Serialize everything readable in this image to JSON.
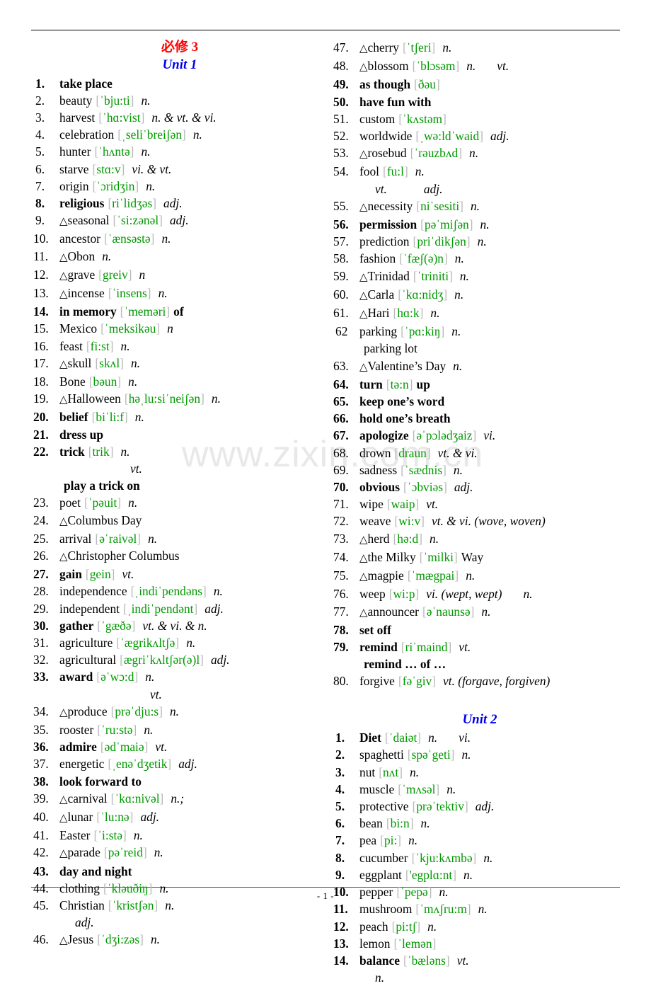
{
  "document": {
    "main_heading": "必修 3",
    "footer_page": "- 1 -",
    "watermark": "www.zixin.com.cn"
  },
  "units": [
    {
      "id": "unit-1",
      "heading": "Unit 1",
      "column": "left",
      "entries": [
        {
          "num": "1.",
          "bold": true,
          "tri": "",
          "word": "take place",
          "ph": "",
          "pos": ""
        },
        {
          "num": "2.",
          "bold": false,
          "tri": "",
          "word": "beauty",
          "ph": "ˈbju:ti",
          "pos": "n."
        },
        {
          "num": "3.",
          "bold": false,
          "tri": "",
          "word": "harvest",
          "ph": "ˈhɑ:vist",
          "pos": "n. & vt. & vi."
        },
        {
          "num": "4.",
          "bold": false,
          "tri": "",
          "word": "celebration",
          "ph": "ˌseliˈbreiʃən",
          "pos": "n."
        },
        {
          "num": "5.",
          "bold": false,
          "tri": "",
          "word": "hunter",
          "ph": "ˈhʌntə",
          "pos": "n."
        },
        {
          "num": "6.",
          "bold": false,
          "tri": "",
          "word": "starve",
          "ph": "stɑ:v",
          "pos": "vi. & vt."
        },
        {
          "num": "7.",
          "bold": false,
          "tri": "",
          "word": "origin",
          "ph": "ˈɔridʒin",
          "pos": "n."
        },
        {
          "num": "8.",
          "bold": true,
          "tri": "",
          "word": "religious",
          "ph": "riˈlidʒəs",
          "pos": "adj."
        },
        {
          "num": "9.",
          "bold": false,
          "tri": "△",
          "word": "seasonal",
          "ph": "ˈsi:zənəl",
          "pos": "adj."
        },
        {
          "num": "10.",
          "bold": false,
          "tri": "",
          "word": "ancestor",
          "ph": "ˈænsəstə",
          "pos": "n."
        },
        {
          "num": "11.",
          "bold": false,
          "tri": "△",
          "word": "Obon",
          "ph": "",
          "pos": "n."
        },
        {
          "num": "12.",
          "bold": false,
          "tri": "△",
          "word": "grave",
          "ph": "greiv",
          "pos": "n"
        },
        {
          "num": "13.",
          "bold": false,
          "tri": "△",
          "word": "incense",
          "ph": "ˈinsens",
          "pos": "n."
        },
        {
          "num": "14.",
          "bold": true,
          "tri": "",
          "word": "in memory",
          "ph": "ˈmeməri",
          "pos": "",
          "suffix_bold": "of"
        },
        {
          "num": "15.",
          "bold": false,
          "tri": "",
          "word": "Mexico",
          "ph": "ˈmeksikəu",
          "pos": "n"
        },
        {
          "num": "16.",
          "bold": false,
          "tri": "",
          "word": "feast",
          "ph": "fi:st",
          "pos": "n."
        },
        {
          "num": "17.",
          "bold": false,
          "tri": "△",
          "word": "skull",
          "ph": "skʌl",
          "pos": "n."
        },
        {
          "num": "18.",
          "bold": false,
          "tri": "",
          "word": "Bone",
          "ph": "bəun",
          "pos": "n."
        },
        {
          "num": "19.",
          "bold": false,
          "tri": "△",
          "word": "Halloween",
          "ph": "həˌlu:siˈneiʃən",
          "pos": "n."
        },
        {
          "num": "20.",
          "bold": true,
          "tri": "",
          "word": "belief",
          "ph": "biˈli:f",
          "pos": "n."
        },
        {
          "num": "21.",
          "bold": true,
          "tri": "",
          "word": "dress up",
          "ph": "",
          "pos": ""
        },
        {
          "num": "22.",
          "bold": true,
          "tri": "",
          "word": "trick",
          "ph": "trik",
          "pos": "n."
        },
        {
          "cont": "vt.",
          "indent": 4,
          "italic": true,
          "bold": false
        },
        {
          "cont": "play a trick on",
          "indent": 1,
          "italic": false,
          "bold": true
        },
        {
          "num": "23.",
          "bold": false,
          "tri": "",
          "word": "poet",
          "ph": "ˈpəuit",
          "pos": "n."
        },
        {
          "num": "24.",
          "bold": false,
          "tri": "△",
          "word": "Columbus Day",
          "ph": "",
          "pos": ""
        },
        {
          "num": "25.",
          "bold": false,
          "tri": "",
          "word": "arrival",
          "ph": "əˈraivəl",
          "pos": "n."
        },
        {
          "num": "26.",
          "bold": false,
          "tri": "△",
          "word": "Christopher Columbus",
          "ph": "",
          "pos": ""
        },
        {
          "num": "27.",
          "bold": true,
          "tri": "",
          "word": "gain",
          "ph": "gein",
          "pos": "vt."
        },
        {
          "num": "28.",
          "bold": false,
          "tri": "",
          "word": "independence",
          "ph": "ˌindiˈpendəns",
          "pos": "n."
        },
        {
          "num": "29.",
          "bold": false,
          "tri": "",
          "word": "independent",
          "ph": "ˌindiˈpendənt",
          "pos": "adj."
        },
        {
          "num": "30.",
          "bold": true,
          "tri": "",
          "word": "gather",
          "ph": "ˈgæðə",
          "pos": "vt. & vi. & n."
        },
        {
          "num": "31.",
          "bold": false,
          "tri": "",
          "word": "agriculture",
          "ph": "ˈægrikʌltʃə",
          "pos": "n."
        },
        {
          "num": "32.",
          "bold": false,
          "tri": "",
          "word": "agricultural",
          "ph": "ægriˈkʌltʃər(ə)l",
          "pos": "adj."
        },
        {
          "num": "33.",
          "bold": true,
          "tri": "",
          "word": "award",
          "ph": "əˈwɔ:d",
          "pos": "n."
        },
        {
          "cont": "vt.",
          "indent": 5,
          "italic": true,
          "bold": false
        },
        {
          "num": "34.",
          "bold": false,
          "tri": "△",
          "word": "produce",
          "ph": "prəˈdju:s",
          "pos": "n."
        },
        {
          "num": "35.",
          "bold": false,
          "tri": "",
          "word": "rooster",
          "ph": "ˈru:stə",
          "pos": "n."
        },
        {
          "num": "36.",
          "bold": true,
          "tri": "",
          "word": "admire",
          "ph": "ədˈmaiə",
          "pos": "vt."
        },
        {
          "num": "37.",
          "bold": false,
          "tri": "",
          "word": "energetic",
          "ph": "ˌenəˈdʒetik",
          "pos": "adj."
        },
        {
          "num": "38.",
          "bold": true,
          "tri": "",
          "word": "look forward to",
          "ph": "",
          "pos": ""
        },
        {
          "num": "39.",
          "bold": false,
          "tri": "△",
          "word": "carnival",
          "ph": "ˈkɑ:nivəl",
          "pos": "n.;"
        },
        {
          "num": "40.",
          "bold": false,
          "tri": "△",
          "word": "lunar",
          "ph": "ˈlu:nə",
          "pos": "adj."
        },
        {
          "num": "41.",
          "bold": false,
          "tri": "",
          "word": "Easter",
          "ph": "ˈi:stə",
          "pos": "n."
        },
        {
          "num": "42.",
          "bold": false,
          "tri": "△",
          "word": "parade",
          "ph": "pəˈreid",
          "pos": "n."
        },
        {
          "num": "43.",
          "bold": true,
          "tri": "",
          "word": "day and night",
          "ph": "",
          "pos": ""
        },
        {
          "num": "44.",
          "bold": false,
          "tri": "",
          "word": "clothing",
          "ph": "ˈkləuðiŋ",
          "pos": "n."
        },
        {
          "num": "45.",
          "bold": false,
          "tri": "",
          "word": "Christian",
          "ph": "ˈkristʃən",
          "pos": "n."
        },
        {
          "cont": "adj.",
          "indent": 2,
          "italic": true,
          "bold": false
        },
        {
          "num": "46.",
          "bold": false,
          "tri": "△",
          "word": "Jesus",
          "ph": "ˈdʒi:zəs",
          "pos": "n."
        }
      ]
    },
    {
      "id": "unit-1-cont",
      "heading": "",
      "column": "right",
      "entries": [
        {
          "num": "47.",
          "bold": false,
          "tri": "△",
          "word": "cherry",
          "ph": "ˈtʃeri",
          "pos": "n."
        },
        {
          "num": "48.",
          "bold": false,
          "tri": "△",
          "word": "blossom",
          "ph": "ˈblɔsəm",
          "pos": "n.",
          "pos2": "vt."
        },
        {
          "num": "49.",
          "bold": true,
          "tri": "",
          "word": "as though",
          "ph": "ðəu",
          "pos": ""
        },
        {
          "num": "50.",
          "bold": true,
          "tri": "",
          "word": "have fun with",
          "ph": "",
          "pos": ""
        },
        {
          "num": "51.",
          "bold": false,
          "tri": "",
          "word": "custom",
          "ph": "ˈkʌstəm",
          "pos": ""
        },
        {
          "num": "52.",
          "bold": false,
          "tri": "",
          "word": "worldwide",
          "ph": "ˌwə:ldˈwaid",
          "pos": "adj."
        },
        {
          "num": "53.",
          "bold": false,
          "tri": "△",
          "word": "rosebud",
          "ph": "ˈrəuzbʌd",
          "pos": "n."
        },
        {
          "num": "54.",
          "bold": false,
          "tri": "",
          "word": "fool",
          "ph": "fu:l",
          "pos": "n."
        },
        {
          "cont": "vt.",
          "indent": 2,
          "italic": true,
          "bold": false,
          "cont2": "adj."
        },
        {
          "num": "55.",
          "bold": false,
          "tri": "△",
          "word": "necessity",
          "ph": "niˈsesiti",
          "pos": "n."
        },
        {
          "num": "56.",
          "bold": true,
          "tri": "",
          "word": "permission",
          "ph": "pəˈmiʃən",
          "pos": "n."
        },
        {
          "num": "57.",
          "bold": false,
          "tri": "",
          "word": "prediction",
          "ph": "priˈdikʃən",
          "pos": "n.",
          "nodot": true
        },
        {
          "num": "58.",
          "bold": false,
          "tri": "",
          "word": "fashion",
          "ph": "ˈfæʃ(ə)n",
          "pos": "n."
        },
        {
          "num": "59.",
          "bold": false,
          "tri": "△",
          "word": "Trinidad",
          "ph": "ˈtriniti",
          "pos": "n."
        },
        {
          "num": "60.",
          "bold": false,
          "tri": "△",
          "word": "Carla",
          "ph": "ˈkɑ:nidʒ",
          "pos": "n."
        },
        {
          "num": "61.",
          "bold": false,
          "tri": "△",
          "word": "Hari",
          "ph": "hɑ:k",
          "pos": "n."
        },
        {
          "num": "62",
          "bold": false,
          "tri": "",
          "word": "parking",
          "ph": "ˈpɑ:kiŋ",
          "pos": "n.",
          "nodot": true
        },
        {
          "cont": "parking lot",
          "indent": 1,
          "italic": false,
          "bold": false
        },
        {
          "num": "63.",
          "bold": false,
          "tri": "△",
          "word": "Valentine’s Day",
          "ph": "",
          "pos": "n."
        },
        {
          "num": "64.",
          "bold": true,
          "tri": "",
          "word": "turn",
          "ph": "tə:n",
          "pos": "",
          "suffix_bold": "up"
        },
        {
          "num": "65.",
          "bold": true,
          "tri": "",
          "word": "keep one’s word",
          "ph": "",
          "pos": ""
        },
        {
          "num": "66.",
          "bold": true,
          "tri": "",
          "word": "hold one’s breath",
          "ph": "",
          "pos": ""
        },
        {
          "num": "67.",
          "bold": true,
          "tri": "",
          "word": "apologize",
          "ph": "əˈpɔlədʒaiz",
          "pos": "vi."
        },
        {
          "num": "68.",
          "bold": false,
          "tri": "",
          "word": "drown",
          "ph": "draun",
          "pos": "vt. & vi."
        },
        {
          "num": "69.",
          "bold": false,
          "tri": "",
          "word": "sadness",
          "ph": "ˈsædnis",
          "pos": "n."
        },
        {
          "num": "70.",
          "bold": true,
          "tri": "",
          "word": "obvious",
          "ph": "ˈɔbviəs",
          "pos": "adj."
        },
        {
          "num": "71.",
          "bold": false,
          "tri": "",
          "word": "wipe",
          "ph": "waip",
          "pos": "vt."
        },
        {
          "num": "72.",
          "bold": false,
          "tri": "",
          "word": "weave",
          "ph": "wi:v",
          "pos": "vt. & vi. (wove, woven)"
        },
        {
          "num": "73.",
          "bold": false,
          "tri": "△",
          "word": "herd",
          "ph": "hə:d",
          "pos": "n."
        },
        {
          "num": "74.",
          "bold": false,
          "tri": "△",
          "word": "the Milky",
          "ph": "ˈmilki",
          "pos": "",
          "suffix": "Way"
        },
        {
          "num": "75.",
          "bold": false,
          "tri": "△",
          "word": "magpie",
          "ph": "ˈmægpai",
          "pos": "n."
        },
        {
          "num": "76.",
          "bold": false,
          "tri": "",
          "word": "weep",
          "ph": "wi:p",
          "pos": "vi. (wept, wept)",
          "pos2": "n."
        },
        {
          "num": "77.",
          "bold": false,
          "tri": "△",
          "word": "announcer",
          "ph": "əˈnaunsə",
          "pos": "n."
        },
        {
          "num": "78.",
          "bold": true,
          "tri": "",
          "word": "set off",
          "ph": "",
          "pos": ""
        },
        {
          "num": "79.",
          "bold": true,
          "tri": "",
          "word": "remind",
          "ph": "riˈmaind",
          "pos": "vt."
        },
        {
          "cont": "remind … of …",
          "indent": 1,
          "italic": false,
          "bold": true
        },
        {
          "num": "80.",
          "bold": false,
          "tri": "",
          "word": "forgive",
          "ph": "fəˈgiv",
          "pos": "vt. (forgave, forgiven)"
        }
      ]
    },
    {
      "id": "unit-2",
      "heading": "Unit 2",
      "column": "right",
      "entries": [
        {
          "num": "1.",
          "bold": true,
          "tri": "",
          "word": "Diet",
          "ph": "ˈdaiət",
          "pos": "n.",
          "pos2": "vi."
        },
        {
          "num": "2.",
          "bold": true,
          "tri": "",
          "word": "spaghetti",
          "ph": "spəˈgeti",
          "pos": "n.",
          "wordnormal": true
        },
        {
          "num": "3.",
          "bold": true,
          "tri": "",
          "word": "nut",
          "ph": "nʌt",
          "pos": "n.",
          "wordnormal": true
        },
        {
          "num": "4.",
          "bold": true,
          "tri": "",
          "word": "muscle",
          "ph": "ˈmʌsəl",
          "pos": "n.",
          "wordnormal": true
        },
        {
          "num": "5.",
          "bold": true,
          "tri": "",
          "word": "protective",
          "ph": "prəˈtektiv",
          "pos": "adj.",
          "wordnormal": true
        },
        {
          "num": "6.",
          "bold": true,
          "tri": "",
          "word": "bean",
          "ph": "bi:n",
          "pos": "n.",
          "wordnormal": true
        },
        {
          "num": "7.",
          "bold": true,
          "tri": "",
          "word": "pea",
          "ph": "pi:",
          "pos": "n.",
          "wordnormal": true
        },
        {
          "num": "8.",
          "bold": true,
          "tri": "",
          "word": "cucumber",
          "ph": "ˈkju:kʌmbə",
          "pos": "n.",
          "wordnormal": true
        },
        {
          "num": "9.",
          "bold": true,
          "tri": "",
          "word": "eggplant",
          "ph": "'egplɑ:nt",
          "pos": "n.",
          "wordnormal": true
        },
        {
          "num": "10.",
          "bold": true,
          "tri": "",
          "word": "pepper",
          "ph": "ˈpepə",
          "pos": "n.",
          "wordnormal": true
        },
        {
          "num": "11.",
          "bold": true,
          "tri": "",
          "word": "mushroom",
          "ph": "ˈmʌʃru:m",
          "pos": "n.",
          "wordnormal": true
        },
        {
          "num": "12.",
          "bold": true,
          "tri": "",
          "word": "peach",
          "ph": "pi:tʃ",
          "pos": "n.",
          "wordnormal": true
        },
        {
          "num": "13.",
          "bold": true,
          "tri": "",
          "word": "lemon",
          "ph": "ˈlemən",
          "pos": "",
          "wordnormal": true
        },
        {
          "num": "14.",
          "bold": true,
          "tri": "",
          "word": "balance",
          "ph": "ˈbæləns",
          "pos": "vt."
        },
        {
          "cont": "n.",
          "indent": 2,
          "italic": true,
          "bold": false
        }
      ]
    }
  ]
}
